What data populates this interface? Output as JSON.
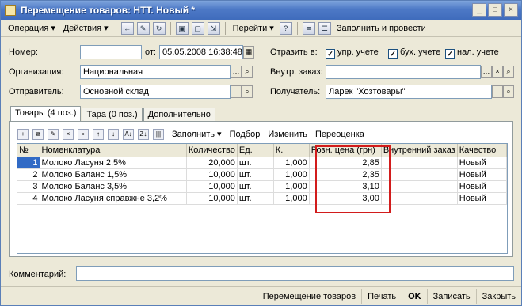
{
  "window": {
    "title": "Перемещение товаров: НТТ. Новый *",
    "minimize": "_",
    "maximize": "□",
    "close": "×"
  },
  "toolbar": {
    "operation": "Операция ▾",
    "actions": "Действия ▾",
    "goto": "Перейти ▾",
    "help": "?",
    "fill_post": "Заполнить и провести"
  },
  "form": {
    "number_label": "Номер:",
    "number_value": "",
    "from_label": "от:",
    "date_value": "05.05.2008 16:38:48",
    "reflect_label": "Отразить в:",
    "chk_mgmt": "упр. учете",
    "chk_acct": "бух. учете",
    "chk_tax": "нал. учете",
    "org_label": "Организация:",
    "org_value": "Национальная",
    "inner_order_label": "Внутр. заказ:",
    "inner_order_value": "",
    "sender_label": "Отправитель:",
    "sender_value": "Основной склад",
    "recipient_label": "Получатель:",
    "recipient_value": "Ларек \"Хозтовары\""
  },
  "tabs": [
    "Товары (4 поз.)",
    "Тара (0 поз.)",
    "Дополнительно"
  ],
  "grid_toolbar": {
    "fill": "Заполнить ▾",
    "select": "Подбор",
    "change": "Изменить",
    "reprice": "Переоценка"
  },
  "table": {
    "headers": [
      "№",
      "Номенклатура",
      "Количество",
      "Ед.",
      "К.",
      "Розн. цена (грн)",
      "Внутренний заказ",
      "Качество"
    ],
    "rows": [
      [
        "1",
        "Молоко Ласуня 2,5%",
        "20,000",
        "шт.",
        "1,000",
        "2,85",
        "",
        "Новый"
      ],
      [
        "2",
        "Молоко Баланс 1,5%",
        "10,000",
        "шт.",
        "1,000",
        "2,35",
        "",
        "Новый"
      ],
      [
        "3",
        "Молоко Баланс 3,5%",
        "10,000",
        "шт.",
        "1,000",
        "3,10",
        "",
        "Новый"
      ],
      [
        "4",
        "Молоко Ласуня справжне 3,2%",
        "10,000",
        "шт.",
        "1,000",
        "3,00",
        "",
        "Новый"
      ]
    ]
  },
  "comment": {
    "label": "Комментарий:",
    "value": ""
  },
  "bottom": {
    "doc_move": "Перемещение товаров",
    "print": "Печать",
    "ok": "OK",
    "save": "Записать",
    "close": "Закрыть"
  }
}
